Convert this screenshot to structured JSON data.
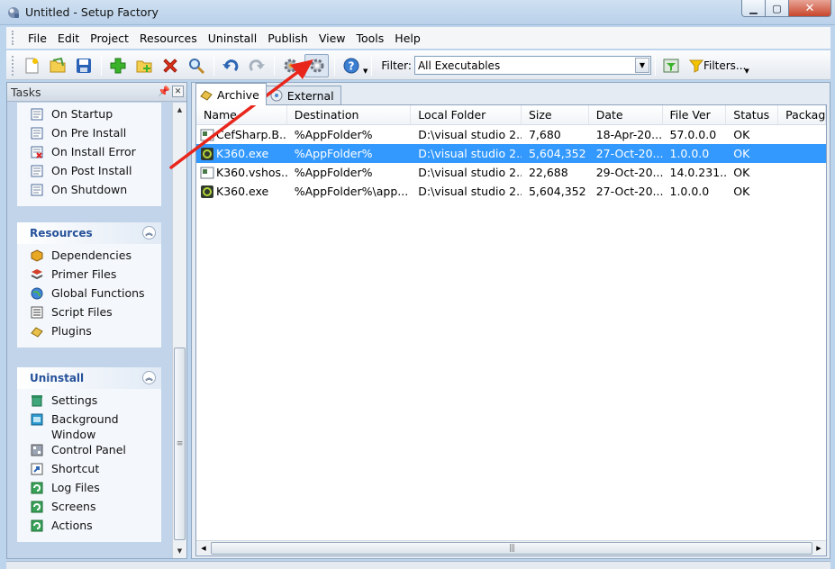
{
  "window": {
    "title": "Untitled - Setup Factory",
    "min_label": "▁",
    "max_label": "▢",
    "close_label": "✕"
  },
  "menu": [
    "File",
    "Edit",
    "Project",
    "Resources",
    "Uninstall",
    "Publish",
    "View",
    "Tools",
    "Help"
  ],
  "toolbar": {
    "filter_label": "Filter:",
    "filter_value": "All Executables",
    "filters_button": "Filters..."
  },
  "tasks": {
    "title": "Tasks",
    "events": [
      "On Startup",
      "On Pre Install",
      "On Install Error",
      "On Post Install",
      "On Shutdown"
    ],
    "resources_title": "Resources",
    "resources": [
      "Dependencies",
      "Primer Files",
      "Global Functions",
      "Script Files",
      "Plugins"
    ],
    "uninstall_title": "Uninstall",
    "uninstall": [
      "Settings",
      "Background Window",
      "Control Panel",
      "Shortcut",
      "Log Files",
      "Screens",
      "Actions"
    ]
  },
  "tabs": [
    "Archive",
    "External"
  ],
  "table": {
    "columns": [
      "Name",
      "Destination",
      "Local Folder",
      "Size",
      "Date",
      "File Ver",
      "Status",
      "Packag"
    ],
    "rows": [
      [
        "CefSharp.B...",
        "%AppFolder%",
        "D:\\visual studio 2...",
        "7,680",
        "18-Apr-20...",
        "57.0.0.0",
        "OK",
        ""
      ],
      [
        "K360.exe",
        "%AppFolder%",
        "D:\\visual studio 2...",
        "5,604,352",
        "27-Oct-20...",
        "1.0.0.0",
        "OK",
        ""
      ],
      [
        "K360.vshos...",
        "%AppFolder%",
        "D:\\visual studio 2...",
        "22,688",
        "29-Oct-20...",
        "14.0.231...",
        "OK",
        ""
      ],
      [
        "K360.exe",
        "%AppFolder%\\app...",
        "D:\\visual studio 2...",
        "5,604,352",
        "27-Oct-20...",
        "1.0.0.0",
        "OK",
        ""
      ]
    ],
    "selected_row": 1
  },
  "colors": {
    "selection": "#3399ff",
    "group_header_text": "#26529a",
    "arrow": "#e8261c"
  }
}
